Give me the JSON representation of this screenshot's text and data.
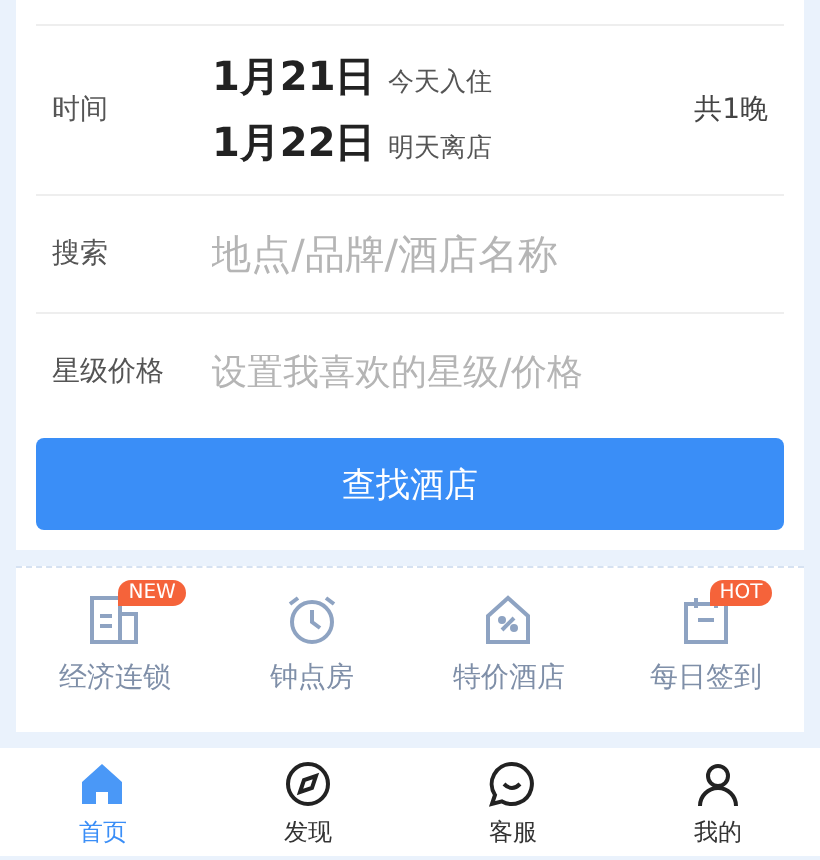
{
  "form": {
    "time": {
      "label": "时间",
      "checkin_date": "1月21日",
      "checkin_note": "今天入住",
      "checkout_date": "1月22日",
      "checkout_note": "明天离店",
      "nights": "共1晚"
    },
    "search": {
      "label": "搜索",
      "placeholder": "地点/品牌/酒店名称"
    },
    "star_price": {
      "label": "星级价格",
      "placeholder": "设置我喜欢的星级/价格"
    },
    "submit": "查找酒店"
  },
  "categories": [
    {
      "kind": "building",
      "label": "经济连锁",
      "badge": "NEW"
    },
    {
      "kind": "clock",
      "label": "钟点房"
    },
    {
      "kind": "tag",
      "label": "特价酒店"
    },
    {
      "kind": "calendar",
      "label": "每日签到",
      "badge": "HOT"
    }
  ],
  "tab_bar": [
    {
      "kind": "home",
      "label": "首页",
      "selected": true
    },
    {
      "kind": "compass",
      "label": "发现",
      "selected": false
    },
    {
      "kind": "chat",
      "label": "客服",
      "selected": false
    },
    {
      "kind": "person",
      "label": "我的",
      "selected": false
    }
  ]
}
